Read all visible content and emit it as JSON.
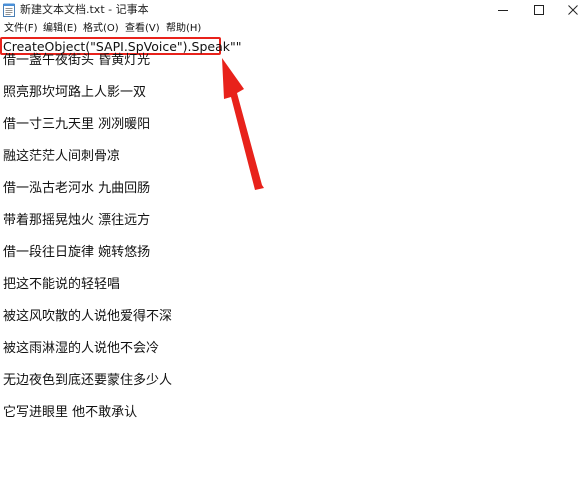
{
  "window": {
    "title": "新建文本文档.txt - 记事本"
  },
  "menu": {
    "file": "文件(F)",
    "edit": "编辑(E)",
    "format": "格式(O)",
    "view": "查看(V)",
    "help": "帮助(H)"
  },
  "editor": {
    "code_line": "CreateObject(\"SAPI.SpVoice\").Speak\"\"",
    "lines": [
      "借一盏午夜街头 昏黄灯光",
      "照亮那坎坷路上人影一双",
      "借一寸三九天里 冽冽暖阳",
      "融这茫茫人间刺骨凉",
      "借一泓古老河水 九曲回肠",
      "带着那摇晃烛火 漂往远方",
      "借一段往日旋律 婉转悠扬",
      "把这不能说的轻轻唱",
      "被这风吹散的人说他爱得不深",
      "被这雨淋湿的人说他不会冷",
      "无边夜色到底还要蒙住多少人",
      "它写进眼里 他不敢承认"
    ]
  },
  "annotation": {
    "color": "#e8221b"
  }
}
